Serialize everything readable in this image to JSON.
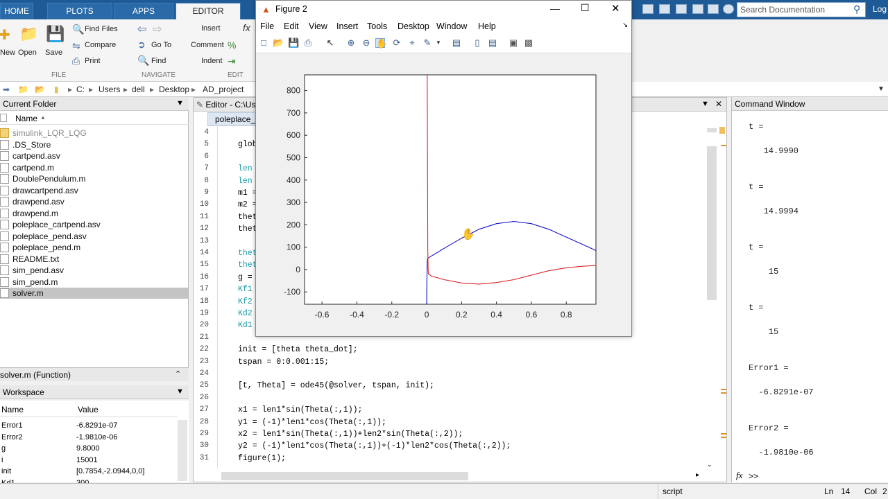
{
  "tabs": [
    "HOME",
    "PLOTS",
    "APPS",
    "EDITOR"
  ],
  "search_placeholder": "Search Documentation",
  "log_text": "Log",
  "ribbon": {
    "new": "New",
    "open": "Open",
    "save": "Save",
    "find_files": "Find Files",
    "compare": "Compare",
    "print": "Print",
    "go_to": "Go To",
    "find": "Find",
    "insert": "Insert",
    "comment": "Comment",
    "indent": "Indent",
    "sec_file": "FILE",
    "sec_navigate": "NAVIGATE",
    "sec_edit": "EDIT"
  },
  "path": [
    "C:",
    "Users",
    "dell",
    "Desktop",
    "AD_project"
  ],
  "folder": {
    "title": "Current Folder",
    "name_col": "Name",
    "files": [
      "simulink_LQR_LQG",
      ".DS_Store",
      "cartpend.asv",
      "cartpend.m",
      "DoublePendulum.m",
      "drawcartpend.asv",
      "drawpend.asv",
      "drawpend.m",
      "poleplace_cartpend.asv",
      "poleplace_pend.asv",
      "poleplace_pend.m",
      "README.txt",
      "sim_pend.asv",
      "sim_pend.m",
      "solver.m"
    ],
    "selected": "solver.m",
    "detail": "solver.m  (Function)"
  },
  "workspace": {
    "title": "Workspace",
    "name_col": "Name",
    "value_col": "Value",
    "rows": [
      {
        "n": "Error1",
        "v": "-6.8291e-07"
      },
      {
        "n": "Error2",
        "v": "-1.9810e-06"
      },
      {
        "n": "g",
        "v": "9.8000"
      },
      {
        "n": "i",
        "v": "15001"
      },
      {
        "n": "init",
        "v": "[0.7854,-2.0944,0,0]"
      },
      {
        "n": "Kd1",
        "v": "300"
      }
    ]
  },
  "editor": {
    "title": "Editor - C:\\Us",
    "tab": "poleplace_p",
    "lines": [
      {
        "n": "4",
        "t": ""
      },
      {
        "n": "5",
        "t": "glob"
      },
      {
        "n": "6",
        "t": ""
      },
      {
        "n": "7",
        "t": "len"
      },
      {
        "n": "8",
        "t": "len"
      },
      {
        "n": "9",
        "t": "m1 ="
      },
      {
        "n": "10",
        "t": "m2 ="
      },
      {
        "n": "11",
        "t": "thet"
      },
      {
        "n": "12",
        "t": "thet"
      },
      {
        "n": "13",
        "t": ""
      },
      {
        "n": "14",
        "t": "thet"
      },
      {
        "n": "15",
        "t": "thet"
      },
      {
        "n": "16",
        "t": "g ="
      },
      {
        "n": "17",
        "t": "Kf1"
      },
      {
        "n": "18",
        "t": "Kf2"
      },
      {
        "n": "19",
        "t": "Kd2"
      },
      {
        "n": "20",
        "t": "Kd1"
      },
      {
        "n": "21",
        "t": ""
      },
      {
        "n": "22",
        "t": "init = [theta theta_dot];"
      },
      {
        "n": "23",
        "t": "tspan = 0:0.001:15;"
      },
      {
        "n": "24",
        "t": ""
      },
      {
        "n": "25",
        "t": "[t, Theta] = ode45(@solver, tspan, init);"
      },
      {
        "n": "26",
        "t": ""
      },
      {
        "n": "27",
        "t": "x1 = len1*sin(Theta(:,1));"
      },
      {
        "n": "28",
        "t": "y1 = (-1)*len1*cos(Theta(:,1));"
      },
      {
        "n": "29",
        "t": "x2 = len1*sin(Theta(:,1))+len2*sin(Theta(:,2));"
      },
      {
        "n": "30",
        "t": "y2 = (-1)*len1*cos(Theta(:,1))+(-1)*len2*cos(Theta(:,2));"
      },
      {
        "n": "31",
        "t": "figure(1);"
      }
    ]
  },
  "command": {
    "title": "Command Window",
    "lines": [
      "t =",
      "",
      "   14.9990",
      "",
      "",
      "t =",
      "",
      "   14.9994",
      "",
      "",
      "t =",
      "",
      "    15",
      "",
      "",
      "t =",
      "",
      "    15",
      "",
      "",
      "Error1 =",
      "",
      "  -6.8291e-07",
      "",
      "",
      "Error2 =",
      "",
      "  -1.9810e-06"
    ],
    "prompt": ">>",
    "fx": "fx"
  },
  "status": {
    "mode": "script",
    "ln_label": "Ln",
    "ln": "14",
    "col_label": "Col",
    "col": "2"
  },
  "figure": {
    "title": "Figure 2",
    "menu": [
      "File",
      "Edit",
      "View",
      "Insert",
      "Tools",
      "Desktop",
      "Window",
      "Help"
    ]
  },
  "chart_data": {
    "type": "line",
    "title": "",
    "xlabel": "",
    "ylabel": "",
    "xlim": [
      -0.7,
      0.97
    ],
    "ylim": [
      -155,
      870
    ],
    "xticks": [
      -0.6,
      -0.4,
      -0.2,
      0,
      0.2,
      0.4,
      0.6,
      0.8
    ],
    "yticks": [
      -100,
      0,
      100,
      200,
      300,
      400,
      500,
      600,
      700,
      800
    ],
    "series": [
      {
        "color": "#1010cc",
        "x": [
          0,
          0.001,
          0.003,
          0.005,
          0.1,
          0.2,
          0.3,
          0.4,
          0.5,
          0.6,
          0.7,
          0.8,
          0.9,
          0.97
        ],
        "y": [
          -155,
          -60,
          30,
          50,
          95,
          140,
          180,
          205,
          215,
          205,
          180,
          145,
          110,
          85
        ]
      },
      {
        "color": "#dd2222",
        "x": [
          0.003,
          0.005,
          0.006,
          0.008,
          0.01,
          0.03,
          0.1,
          0.2,
          0.3,
          0.4,
          0.5,
          0.6,
          0.7,
          0.8,
          0.9,
          0.97
        ],
        "y": [
          870,
          400,
          100,
          0,
          -20,
          -30,
          -45,
          -60,
          -65,
          -58,
          -45,
          -25,
          -5,
          8,
          15,
          18
        ]
      }
    ]
  }
}
